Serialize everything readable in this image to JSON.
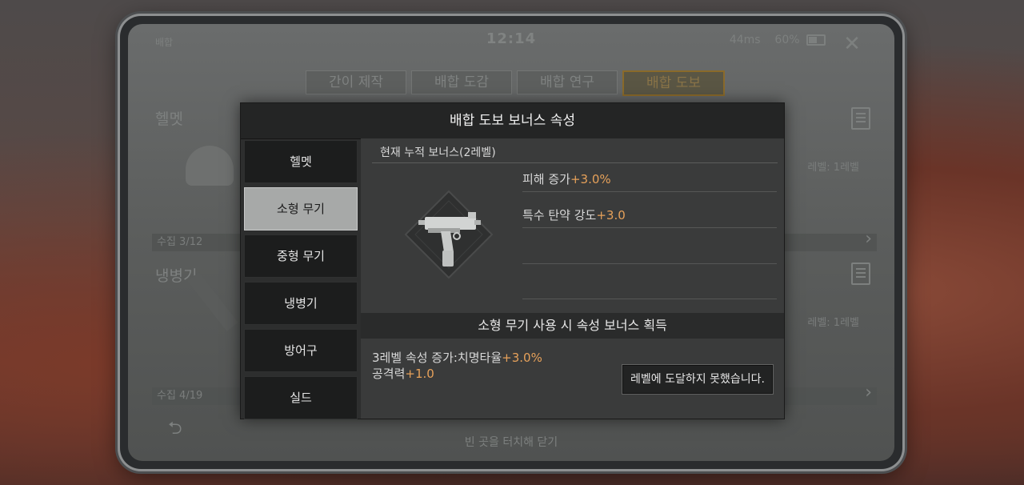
{
  "status": {
    "left_text": "배합",
    "time": "12:14",
    "ping": "44ms",
    "battery": "60%"
  },
  "tabs": [
    {
      "label": "간이 제작"
    },
    {
      "label": "배합 도감"
    },
    {
      "label": "배합 연구"
    },
    {
      "label": "배합 도보"
    }
  ],
  "background": {
    "helmet_label": "헬멧",
    "melee_label": "냉병기",
    "collect_1": "수집 3/12",
    "collect_2": "수집 4/19",
    "level_1": "레벨: 1레벨",
    "level_2": "레벨: 1레벨",
    "hint": "빈 곳을 터치해 닫기"
  },
  "modal": {
    "title": "배합 도보 보너스 속성",
    "categories": [
      {
        "label": "헬멧"
      },
      {
        "label": "소형 무기"
      },
      {
        "label": "중형 무기"
      },
      {
        "label": "냉병기"
      },
      {
        "label": "방어구"
      },
      {
        "label": "실드"
      }
    ],
    "current_header": "현재 누적 보너스(2레벨)",
    "stats": [
      {
        "name": "피해 증가",
        "value": "+3.0%"
      },
      {
        "name": "특수 탄약 강도",
        "value": "+3.0"
      }
    ],
    "gain_header": "소형 무기 사용 시 속성 보너스 획득",
    "next_bonus": {
      "line1_prefix": "3레벨 속성 증가:치명타율",
      "line1_value": "+3.0%",
      "line2_prefix": "공격력",
      "line2_value": "+1.0"
    },
    "level_button": "레벨에 도달하지 못했습니다."
  }
}
